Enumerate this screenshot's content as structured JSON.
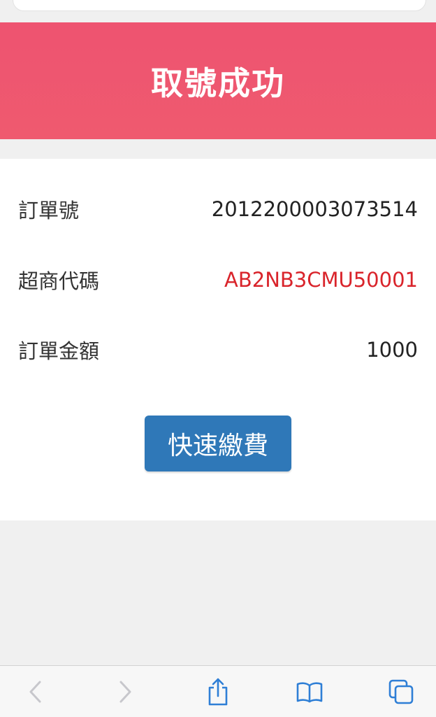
{
  "header": {
    "title": "取號成功"
  },
  "order": {
    "rows": [
      {
        "label": "訂單號",
        "value": "2012200003073514"
      },
      {
        "label": "超商代碼",
        "value": "AB2NB3CMU50001"
      },
      {
        "label": "訂單金額",
        "value": "1000"
      }
    ]
  },
  "actions": {
    "pay_label": "快速繳費"
  },
  "colors": {
    "header": "#ee5370",
    "code_value": "#d9242b",
    "button": "#2f78b8",
    "toolbar_active": "#2f7fd6",
    "toolbar_disabled": "#c7c7cc"
  },
  "toolbar": {
    "items": [
      "back-icon",
      "forward-icon",
      "share-icon",
      "bookmarks-icon",
      "tabs-icon"
    ]
  }
}
